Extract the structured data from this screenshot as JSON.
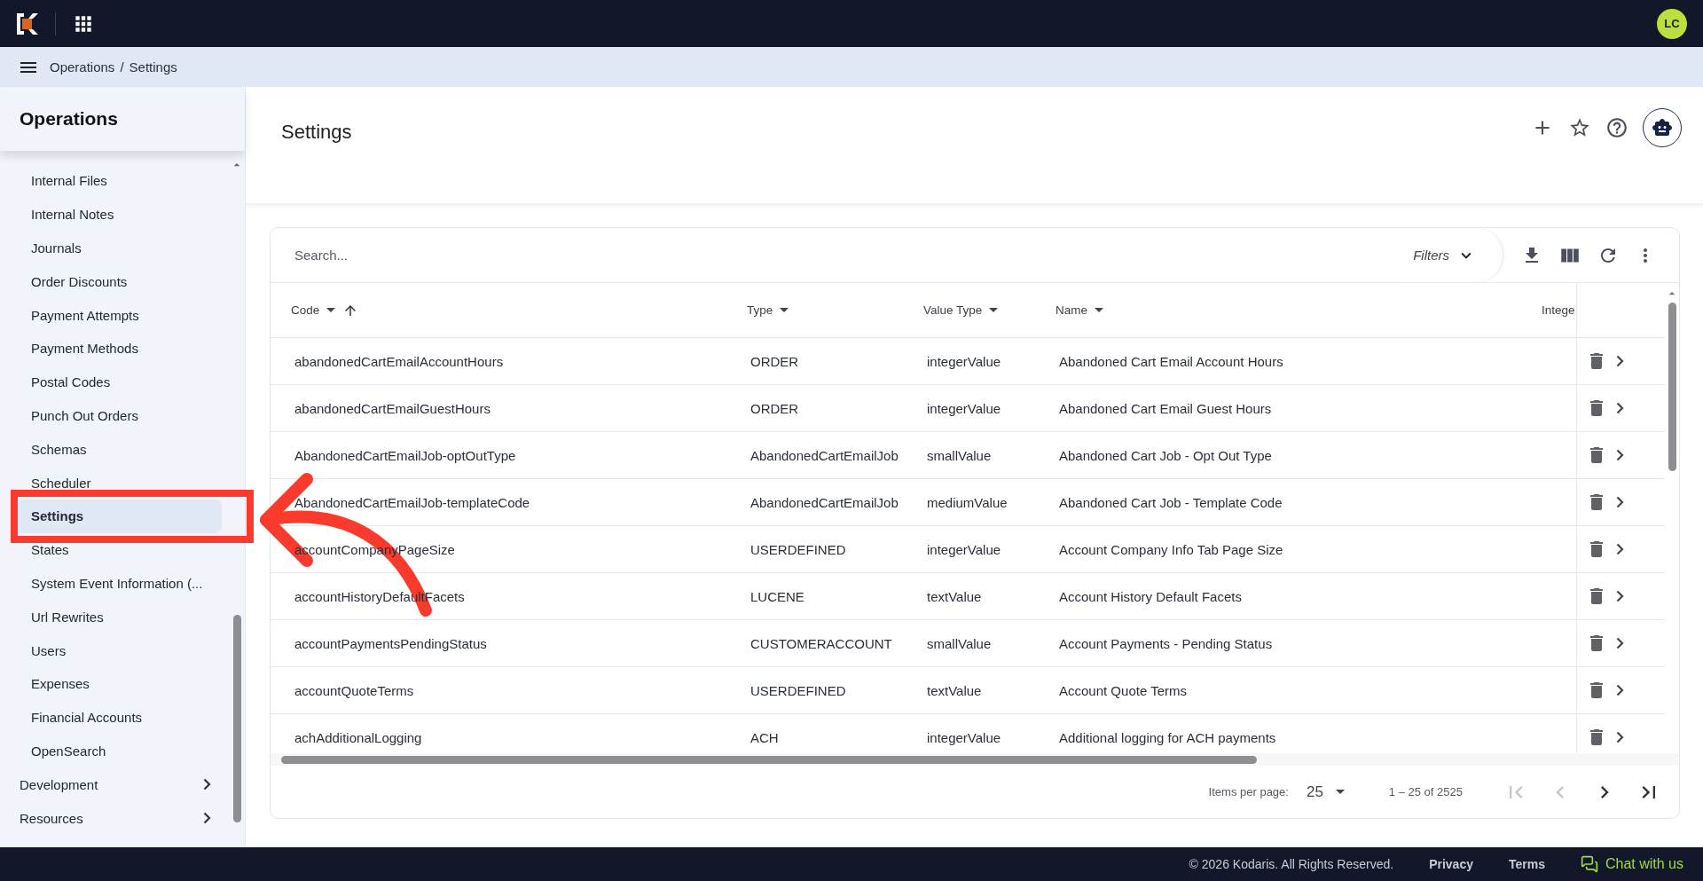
{
  "top_bar": {
    "avatar": "LC"
  },
  "breadcrumb": {
    "items": [
      "Operations",
      "Settings"
    ],
    "separator": "/"
  },
  "sidebar": {
    "title": "Operations",
    "items": [
      {
        "label": "Internal Files",
        "kind": "link",
        "selected": false
      },
      {
        "label": "Internal Notes",
        "kind": "link",
        "selected": false
      },
      {
        "label": "Journals",
        "kind": "link",
        "selected": false
      },
      {
        "label": "Order Discounts",
        "kind": "link",
        "selected": false
      },
      {
        "label": "Payment Attempts",
        "kind": "link",
        "selected": false
      },
      {
        "label": "Payment Methods",
        "kind": "link",
        "selected": false
      },
      {
        "label": "Postal Codes",
        "kind": "link",
        "selected": false
      },
      {
        "label": "Punch Out Orders",
        "kind": "link",
        "selected": false
      },
      {
        "label": "Schemas",
        "kind": "link",
        "selected": false
      },
      {
        "label": "Scheduler",
        "kind": "link",
        "selected": false
      },
      {
        "label": "Settings",
        "kind": "link",
        "selected": true
      },
      {
        "label": "States",
        "kind": "link",
        "selected": false
      },
      {
        "label": "System Event Information (...",
        "kind": "link",
        "selected": false
      },
      {
        "label": "Url Rewrites",
        "kind": "link",
        "selected": false
      },
      {
        "label": "Users",
        "kind": "link",
        "selected": false
      },
      {
        "label": "Expenses",
        "kind": "link",
        "selected": false
      },
      {
        "label": "Financial Accounts",
        "kind": "link",
        "selected": false
      },
      {
        "label": "OpenSearch",
        "kind": "link",
        "selected": false
      },
      {
        "label": "Development",
        "kind": "group",
        "selected": false
      },
      {
        "label": "Resources",
        "kind": "group",
        "selected": false
      }
    ]
  },
  "page": {
    "title": "Settings"
  },
  "table": {
    "search": {
      "placeholder": "Search..."
    },
    "filters": "Filters",
    "columns": [
      {
        "label": "Code",
        "sorted": true
      },
      {
        "label": "Type",
        "sorted": false
      },
      {
        "label": "Value Type",
        "sorted": false
      },
      {
        "label": "Name",
        "sorted": false
      },
      {
        "label": "Intege",
        "sorted": false
      }
    ],
    "rows": [
      {
        "code": "abandonedCartEmailAccountHours",
        "type": "ORDER",
        "value_type": "integerValue",
        "name": "Abandoned Cart Email Account Hours"
      },
      {
        "code": "abandonedCartEmailGuestHours",
        "type": "ORDER",
        "value_type": "integerValue",
        "name": "Abandoned Cart Email Guest Hours"
      },
      {
        "code": "AbandonedCartEmailJob-optOutType",
        "type": "AbandonedCartEmailJob",
        "value_type": "smallValue",
        "name": "Abandoned Cart Job - Opt Out Type"
      },
      {
        "code": "AbandonedCartEmailJob-templateCode",
        "type": "AbandonedCartEmailJob",
        "value_type": "mediumValue",
        "name": "Abandoned Cart Job - Template Code"
      },
      {
        "code": "accountCompanyPageSize",
        "type": "USERDEFINED",
        "value_type": "integerValue",
        "name": "Account Company Info Tab Page Size"
      },
      {
        "code": "accountHistoryDefaultFacets",
        "type": "LUCENE",
        "value_type": "textValue",
        "name": "Account History Default Facets"
      },
      {
        "code": "accountPaymentsPendingStatus",
        "type": "CUSTOMERACCOUNT",
        "value_type": "smallValue",
        "name": "Account Payments - Pending Status"
      },
      {
        "code": "accountQuoteTerms",
        "type": "USERDEFINED",
        "value_type": "textValue",
        "name": "Account Quote Terms"
      },
      {
        "code": "achAdditionalLogging",
        "type": "ACH",
        "value_type": "integerValue",
        "name": "Additional logging for ACH payments"
      }
    ],
    "pagination": {
      "label": "Items per page:",
      "page_size": "25",
      "range": "1 – 25 of 2525",
      "first_disabled": true,
      "prev_disabled": true,
      "next_disabled": false,
      "last_disabled": false
    }
  },
  "footer": {
    "copyright": "© 2026 Kodaris. All Rights Reserved.",
    "links": [
      "Privacy",
      "Terms"
    ],
    "chat": "Chat with us"
  },
  "annotation": {
    "kind": "box-and-arrow"
  }
}
